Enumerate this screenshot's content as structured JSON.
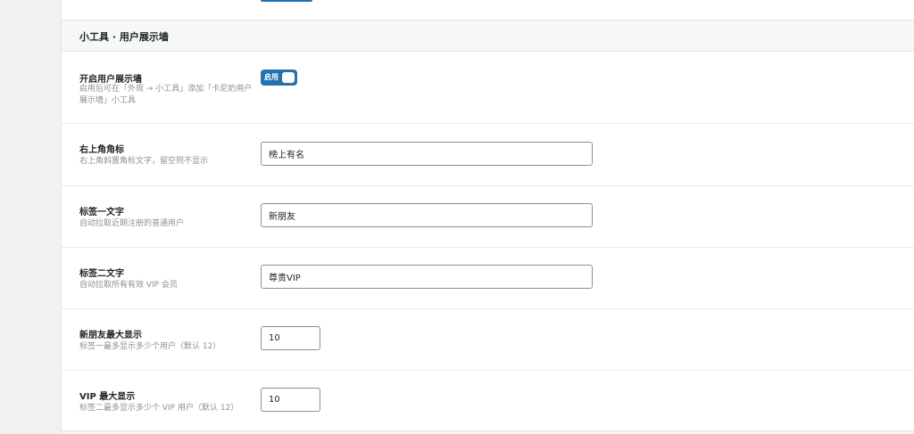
{
  "section": {
    "title": "小工具 · 用户展示墙"
  },
  "fields": {
    "enable_wall": {
      "label": "开启用户展示墙",
      "description": "启用后可在「外观 → 小工具」添加「卡尼奶用户展示墙」小工具",
      "toggle_label": "启用",
      "enabled": true
    },
    "corner_badge": {
      "label": "右上角角标",
      "description": "右上角斜置角标文字，留空则不显示",
      "value": "榜上有名"
    },
    "tag_one_text": {
      "label": "标签一文字",
      "description": "自动拉取近期注册的普通用户",
      "value": "新朋友"
    },
    "tag_two_text": {
      "label": "标签二文字",
      "description": "自动拉取所有有效 VIP 会员",
      "value": "尊贵VIP"
    },
    "new_friends_max": {
      "label": "新朋友最大显示",
      "description": "标签一最多显示多少个用户（默认 12）",
      "value": "10"
    },
    "vip_max": {
      "label": "VIP 最大显示",
      "description": "标签二最多显示多少个 VIP 用户（默认 12）",
      "value": "10"
    }
  },
  "colors": {
    "accent": "#2271b1",
    "background": "#f1f1f1",
    "panel": "#ffffff",
    "muted_text": "#8c8f94"
  }
}
